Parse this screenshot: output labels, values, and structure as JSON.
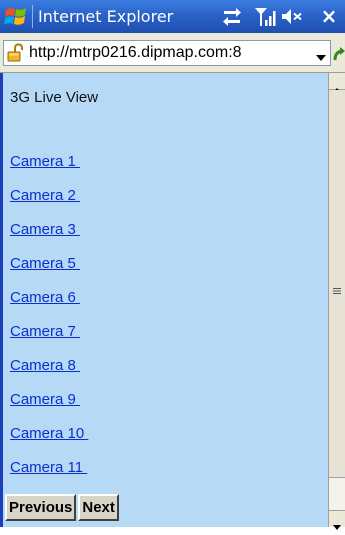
{
  "titlebar": {
    "app_title": "Internet Explorer",
    "close_glyph": "×",
    "background": "#2a63c9"
  },
  "addressbar": {
    "url": "http://mtrp0216.dipmap.com:8"
  },
  "page": {
    "heading": "3G Live View",
    "background": "#b6daf6",
    "link_color": "#0a2fd0",
    "cameras": [
      {
        "label": "Camera 1 "
      },
      {
        "label": "Camera 2 "
      },
      {
        "label": "Camera 3 "
      },
      {
        "label": "Camera 5 "
      },
      {
        "label": "Camera 6 "
      },
      {
        "label": "Camera 7 "
      },
      {
        "label": "Camera 8 "
      },
      {
        "label": "Camera 9 "
      },
      {
        "label": "Camera 10 "
      },
      {
        "label": "Camera 11 "
      }
    ],
    "previous_label": "Previous",
    "next_label": "Next"
  },
  "icons": {
    "logo": "windows-flag-logo-icon",
    "connectivity": "connectivity-arrows-icon",
    "signal": "signal-strength-icon",
    "volume": "volume-icon",
    "close": "close-icon",
    "lock": "lock-icon",
    "dropdown": "chevron-down-icon",
    "go": "go-refresh-icon"
  }
}
